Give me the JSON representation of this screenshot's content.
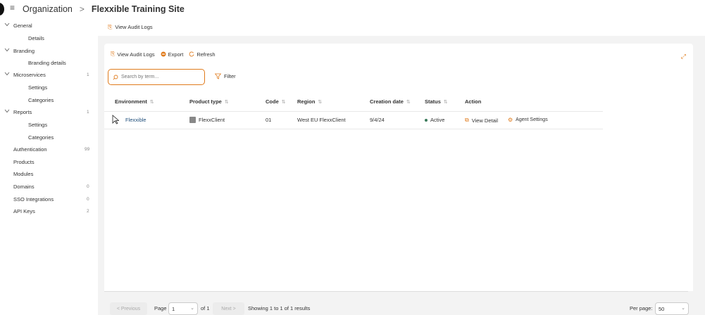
{
  "header": {
    "menu_icon": "hamburger-icon",
    "crumb_parent": "Organization",
    "crumb_sep": ">",
    "crumb_current": "Flexxible Training Site"
  },
  "sidebar": {
    "items": [
      {
        "label": "General",
        "count": "",
        "expandable": true
      },
      {
        "label": "Details",
        "count": "",
        "child": true
      },
      {
        "label": "Branding",
        "count": "",
        "expandable": true
      },
      {
        "label": "Branding details",
        "count": "",
        "child": true
      },
      {
        "label": "Microservices",
        "count": "1",
        "expandable": true
      },
      {
        "label": "Settings",
        "count": "",
        "child": true
      },
      {
        "label": "Categories",
        "count": "",
        "child": true
      },
      {
        "label": "Reports",
        "count": "1",
        "expandable": true
      },
      {
        "label": "Settings",
        "count": "",
        "child": true
      },
      {
        "label": "Categories",
        "count": "",
        "child": true
      },
      {
        "label": "Authentication",
        "count": "99"
      },
      {
        "label": "Products",
        "count": ""
      },
      {
        "label": "Modules",
        "count": ""
      },
      {
        "label": "Domains",
        "count": "0"
      },
      {
        "label": "SSO Integrations",
        "count": "0"
      },
      {
        "label": "API Keys",
        "count": "2"
      }
    ]
  },
  "top_action": {
    "label": "View Audit Logs",
    "icon": "audit-log-icon"
  },
  "toolbar": {
    "audit_label": "View Audit Logs",
    "export_label": "Export",
    "refresh_label": "Refresh"
  },
  "search": {
    "placeholder": "Search by term..."
  },
  "filter": {
    "label": "Filter"
  },
  "table": {
    "headers": {
      "environment": "Environment",
      "product_type": "Product type",
      "code": "Code",
      "region": "Region",
      "creation_date": "Creation date",
      "status": "Status",
      "action": "Action"
    },
    "rows": [
      {
        "environment": "Flexxible",
        "product_type": "FlexxClient",
        "code": "01",
        "region": "West EU FlexxClient",
        "creation_date": "9/4/24",
        "status": "Active",
        "view_detail": "View Detail",
        "agent_settings": "Agent Settings"
      }
    ]
  },
  "pagination": {
    "previous": "< Previous",
    "page_label": "Page",
    "page_value": "1",
    "of_label": "of 1",
    "next": "Next >",
    "showing": "Showing 1 to 1 of 1 results",
    "per_page_label": "Per page:",
    "per_page_value": "50"
  },
  "colors": {
    "accent": "#e07b1c",
    "link": "#1f4e7a",
    "status_active": "#3a7a5a"
  }
}
